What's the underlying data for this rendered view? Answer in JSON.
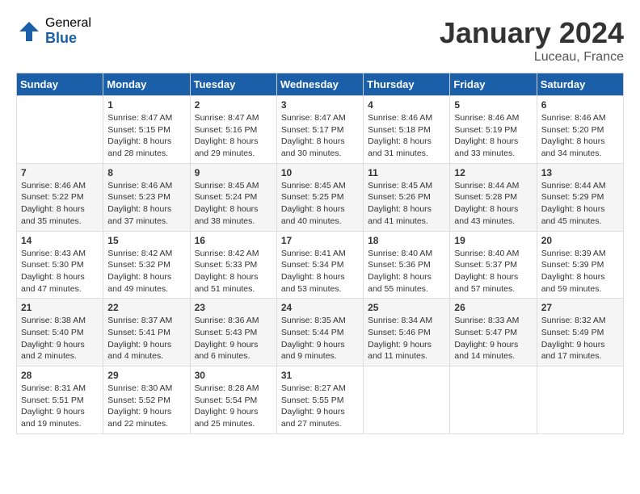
{
  "logo": {
    "general": "General",
    "blue": "Blue"
  },
  "header": {
    "month_title": "January 2024",
    "location": "Luceau, France"
  },
  "weekdays": [
    "Sunday",
    "Monday",
    "Tuesday",
    "Wednesday",
    "Thursday",
    "Friday",
    "Saturday"
  ],
  "weeks": [
    [
      {
        "day": "",
        "sunrise": "",
        "sunset": "",
        "daylight": ""
      },
      {
        "day": "1",
        "sunrise": "Sunrise: 8:47 AM",
        "sunset": "Sunset: 5:15 PM",
        "daylight": "Daylight: 8 hours and 28 minutes."
      },
      {
        "day": "2",
        "sunrise": "Sunrise: 8:47 AM",
        "sunset": "Sunset: 5:16 PM",
        "daylight": "Daylight: 8 hours and 29 minutes."
      },
      {
        "day": "3",
        "sunrise": "Sunrise: 8:47 AM",
        "sunset": "Sunset: 5:17 PM",
        "daylight": "Daylight: 8 hours and 30 minutes."
      },
      {
        "day": "4",
        "sunrise": "Sunrise: 8:46 AM",
        "sunset": "Sunset: 5:18 PM",
        "daylight": "Daylight: 8 hours and 31 minutes."
      },
      {
        "day": "5",
        "sunrise": "Sunrise: 8:46 AM",
        "sunset": "Sunset: 5:19 PM",
        "daylight": "Daylight: 8 hours and 33 minutes."
      },
      {
        "day": "6",
        "sunrise": "Sunrise: 8:46 AM",
        "sunset": "Sunset: 5:20 PM",
        "daylight": "Daylight: 8 hours and 34 minutes."
      }
    ],
    [
      {
        "day": "7",
        "sunrise": "Sunrise: 8:46 AM",
        "sunset": "Sunset: 5:22 PM",
        "daylight": "Daylight: 8 hours and 35 minutes."
      },
      {
        "day": "8",
        "sunrise": "Sunrise: 8:46 AM",
        "sunset": "Sunset: 5:23 PM",
        "daylight": "Daylight: 8 hours and 37 minutes."
      },
      {
        "day": "9",
        "sunrise": "Sunrise: 8:45 AM",
        "sunset": "Sunset: 5:24 PM",
        "daylight": "Daylight: 8 hours and 38 minutes."
      },
      {
        "day": "10",
        "sunrise": "Sunrise: 8:45 AM",
        "sunset": "Sunset: 5:25 PM",
        "daylight": "Daylight: 8 hours and 40 minutes."
      },
      {
        "day": "11",
        "sunrise": "Sunrise: 8:45 AM",
        "sunset": "Sunset: 5:26 PM",
        "daylight": "Daylight: 8 hours and 41 minutes."
      },
      {
        "day": "12",
        "sunrise": "Sunrise: 8:44 AM",
        "sunset": "Sunset: 5:28 PM",
        "daylight": "Daylight: 8 hours and 43 minutes."
      },
      {
        "day": "13",
        "sunrise": "Sunrise: 8:44 AM",
        "sunset": "Sunset: 5:29 PM",
        "daylight": "Daylight: 8 hours and 45 minutes."
      }
    ],
    [
      {
        "day": "14",
        "sunrise": "Sunrise: 8:43 AM",
        "sunset": "Sunset: 5:30 PM",
        "daylight": "Daylight: 8 hours and 47 minutes."
      },
      {
        "day": "15",
        "sunrise": "Sunrise: 8:42 AM",
        "sunset": "Sunset: 5:32 PM",
        "daylight": "Daylight: 8 hours and 49 minutes."
      },
      {
        "day": "16",
        "sunrise": "Sunrise: 8:42 AM",
        "sunset": "Sunset: 5:33 PM",
        "daylight": "Daylight: 8 hours and 51 minutes."
      },
      {
        "day": "17",
        "sunrise": "Sunrise: 8:41 AM",
        "sunset": "Sunset: 5:34 PM",
        "daylight": "Daylight: 8 hours and 53 minutes."
      },
      {
        "day": "18",
        "sunrise": "Sunrise: 8:40 AM",
        "sunset": "Sunset: 5:36 PM",
        "daylight": "Daylight: 8 hours and 55 minutes."
      },
      {
        "day": "19",
        "sunrise": "Sunrise: 8:40 AM",
        "sunset": "Sunset: 5:37 PM",
        "daylight": "Daylight: 8 hours and 57 minutes."
      },
      {
        "day": "20",
        "sunrise": "Sunrise: 8:39 AM",
        "sunset": "Sunset: 5:39 PM",
        "daylight": "Daylight: 8 hours and 59 minutes."
      }
    ],
    [
      {
        "day": "21",
        "sunrise": "Sunrise: 8:38 AM",
        "sunset": "Sunset: 5:40 PM",
        "daylight": "Daylight: 9 hours and 2 minutes."
      },
      {
        "day": "22",
        "sunrise": "Sunrise: 8:37 AM",
        "sunset": "Sunset: 5:41 PM",
        "daylight": "Daylight: 9 hours and 4 minutes."
      },
      {
        "day": "23",
        "sunrise": "Sunrise: 8:36 AM",
        "sunset": "Sunset: 5:43 PM",
        "daylight": "Daylight: 9 hours and 6 minutes."
      },
      {
        "day": "24",
        "sunrise": "Sunrise: 8:35 AM",
        "sunset": "Sunset: 5:44 PM",
        "daylight": "Daylight: 9 hours and 9 minutes."
      },
      {
        "day": "25",
        "sunrise": "Sunrise: 8:34 AM",
        "sunset": "Sunset: 5:46 PM",
        "daylight": "Daylight: 9 hours and 11 minutes."
      },
      {
        "day": "26",
        "sunrise": "Sunrise: 8:33 AM",
        "sunset": "Sunset: 5:47 PM",
        "daylight": "Daylight: 9 hours and 14 minutes."
      },
      {
        "day": "27",
        "sunrise": "Sunrise: 8:32 AM",
        "sunset": "Sunset: 5:49 PM",
        "daylight": "Daylight: 9 hours and 17 minutes."
      }
    ],
    [
      {
        "day": "28",
        "sunrise": "Sunrise: 8:31 AM",
        "sunset": "Sunset: 5:51 PM",
        "daylight": "Daylight: 9 hours and 19 minutes."
      },
      {
        "day": "29",
        "sunrise": "Sunrise: 8:30 AM",
        "sunset": "Sunset: 5:52 PM",
        "daylight": "Daylight: 9 hours and 22 minutes."
      },
      {
        "day": "30",
        "sunrise": "Sunrise: 8:28 AM",
        "sunset": "Sunset: 5:54 PM",
        "daylight": "Daylight: 9 hours and 25 minutes."
      },
      {
        "day": "31",
        "sunrise": "Sunrise: 8:27 AM",
        "sunset": "Sunset: 5:55 PM",
        "daylight": "Daylight: 9 hours and 27 minutes."
      },
      {
        "day": "",
        "sunrise": "",
        "sunset": "",
        "daylight": ""
      },
      {
        "day": "",
        "sunrise": "",
        "sunset": "",
        "daylight": ""
      },
      {
        "day": "",
        "sunrise": "",
        "sunset": "",
        "daylight": ""
      }
    ]
  ]
}
